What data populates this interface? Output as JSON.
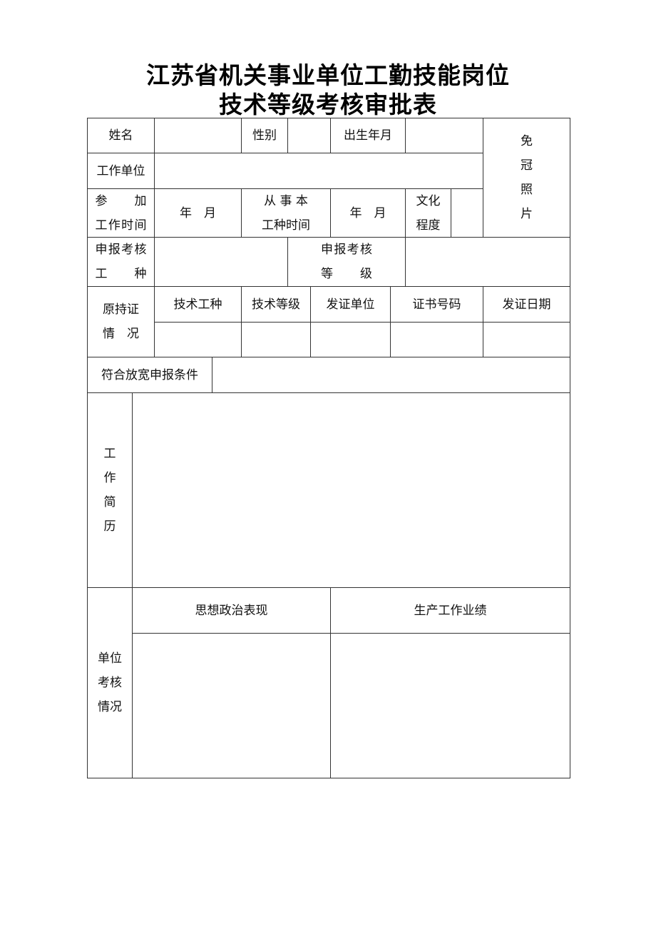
{
  "document": {
    "title_line1": "江苏省机关事业单位工勤技能岗位",
    "title_line2": "技术等级考核审批表"
  },
  "form": {
    "name_label": "姓名",
    "name_value": "",
    "gender_label": "性别",
    "gender_value": "",
    "birth_label": "出生年月",
    "birth_value": "",
    "photo_label": [
      "免",
      "冠",
      "照",
      "片"
    ],
    "work_unit_label": "工作单位",
    "work_unit_value": "",
    "join_work_label_line1": "参　　加",
    "join_work_label_line2": "工作时间",
    "join_work_value": "年　月",
    "trade_time_label_line1": "从 事 本",
    "trade_time_label_line2": "工种时间",
    "trade_time_value": "年　月",
    "education_label_line1": "文化",
    "education_label_line2": "程度",
    "education_value": "",
    "apply_trade_label_line1": "申报考核",
    "apply_trade_label_line2": "工　　种",
    "apply_trade_value": "",
    "apply_level_label_line1": "申报考核",
    "apply_level_label_line2": "等　　级",
    "apply_level_value": "",
    "cert_section_label_line1": "原持证",
    "cert_section_label_line2": "情　况",
    "cert_columns": [
      "技术工种",
      "技术等级",
      "发证单位",
      "证书号码",
      "发证日期"
    ],
    "cert_values": [
      "",
      "",
      "",
      "",
      ""
    ],
    "relaxed_label": "符合放宽申报条件",
    "relaxed_value": "",
    "resume_label": [
      "工",
      "作",
      "简",
      "历"
    ],
    "resume_value": "",
    "unit_review_label": [
      "单位",
      "考核",
      "情况"
    ],
    "political_label": "思想政治表现",
    "political_value": "",
    "performance_label": "生产工作业绩",
    "performance_value": ""
  }
}
